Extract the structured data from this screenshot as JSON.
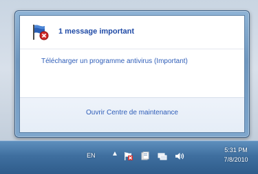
{
  "notification": {
    "title": "1 message important",
    "message": "Télécharger un programme antivirus (Important)",
    "footer_link": "Ouvrir Centre de maintenance",
    "icon": "action-center-flag-error-icon"
  },
  "taskbar": {
    "language": "EN",
    "tray_icons": [
      "show-hidden-icons-chevron",
      "action-center-flag-icon",
      "documents-icon",
      "network-icon",
      "volume-icon"
    ],
    "time": "5:31 PM",
    "date": "7/8/2010"
  },
  "colors": {
    "link": "#2e5db8",
    "title": "#1f4aa6",
    "taskbar": "#3f6f9f"
  }
}
